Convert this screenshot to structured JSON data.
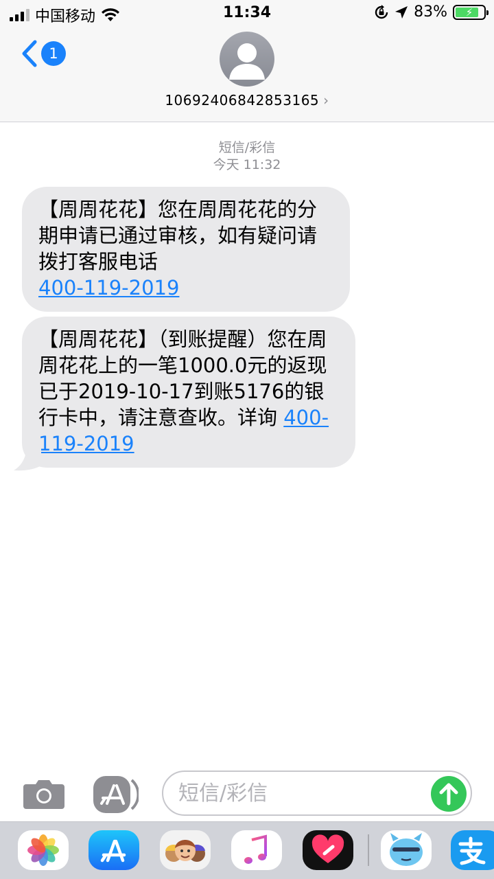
{
  "status_bar": {
    "carrier": "中国移动",
    "time": "11:34",
    "battery_percent": "83%",
    "battery_level": 0.83
  },
  "header": {
    "back_badge": "1",
    "contact_number": "10692406842853165",
    "contact_chevron": "›"
  },
  "thread": {
    "service_label": "短信/彩信",
    "timestamp": "今天 11:32"
  },
  "messages": [
    {
      "text": "【周周花花】您在周周花花的分期申请已通过审核，如有疑问请拨打客服电话",
      "phone": "400-119-2019"
    },
    {
      "text": "【周周花花】（到账提醒）您在周周花花上的一笔1000.0元的返现已于2019-10-17到账5176的银行卡中，请注意查收。详询",
      "phone": "400-119-2019"
    }
  ],
  "composer": {
    "placeholder": "短信/彩信"
  },
  "icons": {
    "camera": "camera-icon",
    "app_store_drawer": "app-store-icon",
    "send": "send-arrow-icon",
    "dock": [
      "photos-icon",
      "app-store-icon",
      "memoji-icon",
      "music-icon",
      "digital-touch-icon",
      "sticker-icon",
      "alipay-icon"
    ]
  },
  "colors": {
    "link_blue": "#1a82fb",
    "bubble_gray": "#e9e9eb",
    "send_green": "#34c759",
    "meta_gray": "#8e8e93"
  }
}
